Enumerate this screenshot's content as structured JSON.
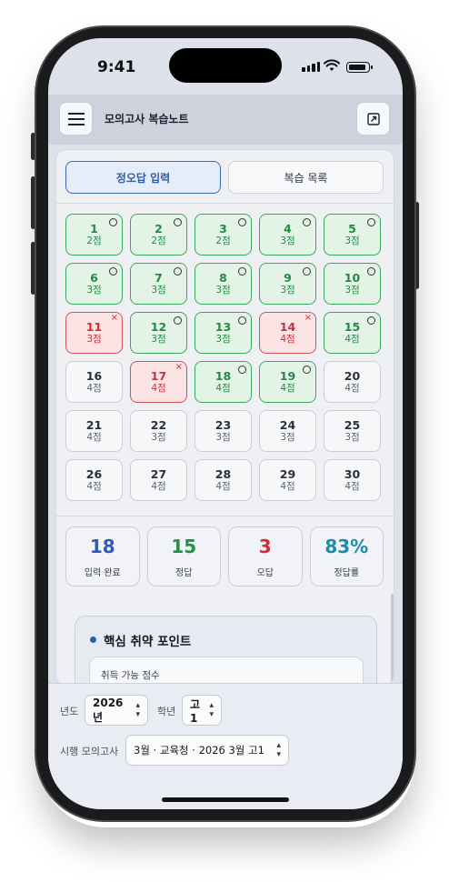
{
  "status_bar": {
    "time": "9:41"
  },
  "header": {
    "title": "모의고사 복습노트"
  },
  "tabs": [
    {
      "label": "정오답 입력",
      "active": true
    },
    {
      "label": "복습 목록",
      "active": false
    }
  ],
  "questions": [
    {
      "num": "1",
      "pts": "2점",
      "status": "correct",
      "mark": "○"
    },
    {
      "num": "2",
      "pts": "2점",
      "status": "correct",
      "mark": "○"
    },
    {
      "num": "3",
      "pts": "2점",
      "status": "correct",
      "mark": "○"
    },
    {
      "num": "4",
      "pts": "3점",
      "status": "correct",
      "mark": "○"
    },
    {
      "num": "5",
      "pts": "3점",
      "status": "correct",
      "mark": "○"
    },
    {
      "num": "6",
      "pts": "3점",
      "status": "correct",
      "mark": "○"
    },
    {
      "num": "7",
      "pts": "3점",
      "status": "correct",
      "mark": "○"
    },
    {
      "num": "8",
      "pts": "3점",
      "status": "correct",
      "mark": "○"
    },
    {
      "num": "9",
      "pts": "3점",
      "status": "correct",
      "mark": "○"
    },
    {
      "num": "10",
      "pts": "3점",
      "status": "correct",
      "mark": "○"
    },
    {
      "num": "11",
      "pts": "3점",
      "status": "wrong",
      "mark": "×"
    },
    {
      "num": "12",
      "pts": "3점",
      "status": "correct",
      "mark": "○"
    },
    {
      "num": "13",
      "pts": "3점",
      "status": "correct",
      "mark": "○"
    },
    {
      "num": "14",
      "pts": "4점",
      "status": "wrong",
      "mark": "×"
    },
    {
      "num": "15",
      "pts": "4점",
      "status": "correct",
      "mark": "○"
    },
    {
      "num": "16",
      "pts": "4점",
      "status": "empty",
      "mark": ""
    },
    {
      "num": "17",
      "pts": "4점",
      "status": "wrong",
      "mark": "×"
    },
    {
      "num": "18",
      "pts": "4점",
      "status": "correct",
      "mark": "○"
    },
    {
      "num": "19",
      "pts": "4점",
      "status": "correct",
      "mark": "○"
    },
    {
      "num": "20",
      "pts": "4점",
      "status": "empty",
      "mark": ""
    },
    {
      "num": "21",
      "pts": "4점",
      "status": "empty",
      "mark": ""
    },
    {
      "num": "22",
      "pts": "3점",
      "status": "empty",
      "mark": ""
    },
    {
      "num": "23",
      "pts": "3점",
      "status": "empty",
      "mark": ""
    },
    {
      "num": "24",
      "pts": "3점",
      "status": "empty",
      "mark": ""
    },
    {
      "num": "25",
      "pts": "3점",
      "status": "empty",
      "mark": ""
    },
    {
      "num": "26",
      "pts": "4점",
      "status": "empty",
      "mark": ""
    },
    {
      "num": "27",
      "pts": "4점",
      "status": "empty",
      "mark": ""
    },
    {
      "num": "28",
      "pts": "4점",
      "status": "empty",
      "mark": ""
    },
    {
      "num": "29",
      "pts": "4점",
      "status": "empty",
      "mark": ""
    },
    {
      "num": "30",
      "pts": "4점",
      "status": "empty",
      "mark": ""
    }
  ],
  "stats": [
    {
      "value": "18",
      "label": "입력 완료",
      "color": "#2f5bb8"
    },
    {
      "value": "15",
      "label": "정답",
      "color": "#229147"
    },
    {
      "value": "3",
      "label": "오답",
      "color": "#d22c34"
    },
    {
      "value": "83%",
      "label": "정답률",
      "color": "#1e8bab"
    }
  ],
  "weak_points": {
    "title": "핵심 취약 포인트",
    "field_label": "취득 가능 점수"
  },
  "filters": {
    "year_label": "년도",
    "year_value": "2026년",
    "grade_label": "학년",
    "grade_value": "고1",
    "exam_label": "시행 모의고사",
    "exam_value": "3월 · 교육청 · 2026 3월 고1"
  },
  "icons": {
    "menu": "hamburger-menu-icon",
    "export": "export-icon",
    "correct_mark": "circle-icon",
    "wrong_mark": "x-icon",
    "select_chevron": "chevron-up-down-icon"
  }
}
